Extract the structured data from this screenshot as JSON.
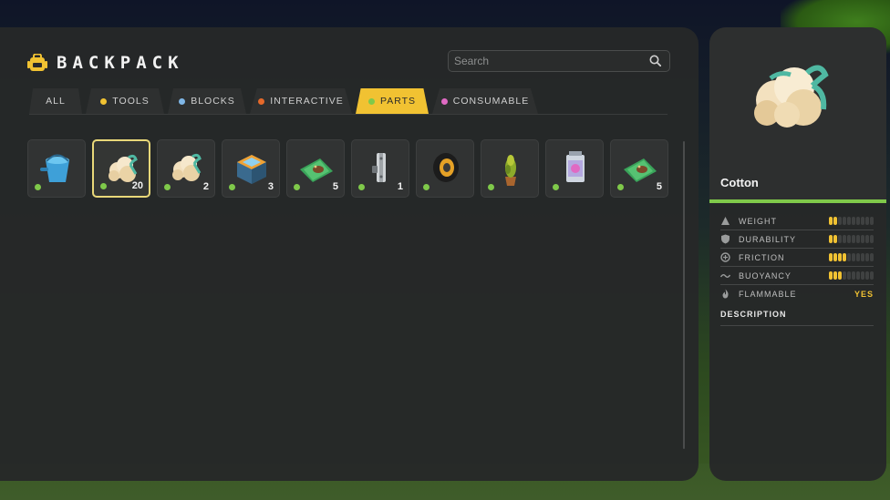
{
  "header": {
    "title": "BACKPACK"
  },
  "search": {
    "placeholder": "Search"
  },
  "tabs": [
    {
      "label": "ALL",
      "dot": ""
    },
    {
      "label": "TOOLS",
      "dot": "#f1c232"
    },
    {
      "label": "BLOCKS",
      "dot": "#7fb6e6"
    },
    {
      "label": "INTERACTIVE",
      "dot": "#e5692a"
    },
    {
      "label": "PARTS",
      "dot": "#7fc94a",
      "active": true
    },
    {
      "label": "CONSUMABLE",
      "dot": "#e06ac3"
    }
  ],
  "items": [
    {
      "icon": "water-bucket-icon",
      "qty": ""
    },
    {
      "icon": "cotton-icon",
      "qty": "20",
      "selected": true
    },
    {
      "icon": "cotton-icon",
      "qty": "2"
    },
    {
      "icon": "generator-box-icon",
      "qty": "3"
    },
    {
      "icon": "seed-packet-icon",
      "qty": "5"
    },
    {
      "icon": "hinge-icon",
      "qty": "1"
    },
    {
      "icon": "wheel-icon",
      "qty": ""
    },
    {
      "icon": "potted-plant-icon",
      "qty": ""
    },
    {
      "icon": "battery-icon",
      "qty": ""
    },
    {
      "icon": "seed-packet-icon",
      "qty": "5"
    }
  ],
  "detail": {
    "name": "Cotton",
    "stats": [
      {
        "label": "WEIGHT",
        "icon": "weight-icon",
        "level": 2,
        "max": 10
      },
      {
        "label": "DURABILITY",
        "icon": "shield-icon",
        "level": 2,
        "max": 10
      },
      {
        "label": "FRICTION",
        "icon": "friction-icon",
        "level": 4,
        "max": 10
      },
      {
        "label": "BUOYANCY",
        "icon": "wave-icon",
        "level": 3,
        "max": 10
      },
      {
        "label": "FLAMMABLE",
        "icon": "flame-icon",
        "value": "YES"
      }
    ],
    "description_label": "DESCRIPTION"
  },
  "colors": {
    "accent": "#f1c232",
    "green": "#7fc94a",
    "panel": "#262828"
  }
}
